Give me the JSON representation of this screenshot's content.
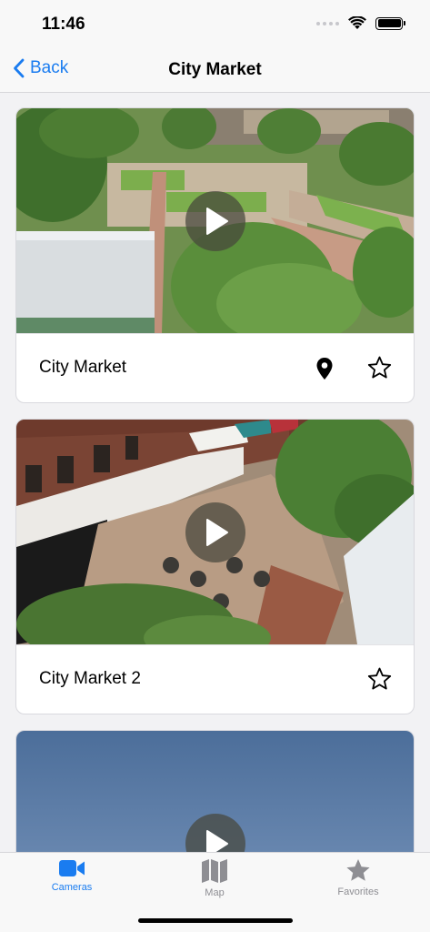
{
  "status_bar": {
    "time": "11:46"
  },
  "nav": {
    "back_label": "Back",
    "title": "City Market"
  },
  "cameras": [
    {
      "name": "City Market",
      "has_location": true,
      "favorite": false
    },
    {
      "name": "City Market 2",
      "has_location": false,
      "favorite": false
    },
    {
      "name": "",
      "has_location": false,
      "favorite": false
    }
  ],
  "tabs": [
    {
      "label": "Cameras",
      "icon": "video-camera-icon",
      "active": true
    },
    {
      "label": "Map",
      "icon": "map-icon",
      "active": false
    },
    {
      "label": "Favorites",
      "icon": "star-icon",
      "active": false
    }
  ],
  "colors": {
    "accent": "#1a7cf0",
    "inactive": "#8e8e93"
  }
}
